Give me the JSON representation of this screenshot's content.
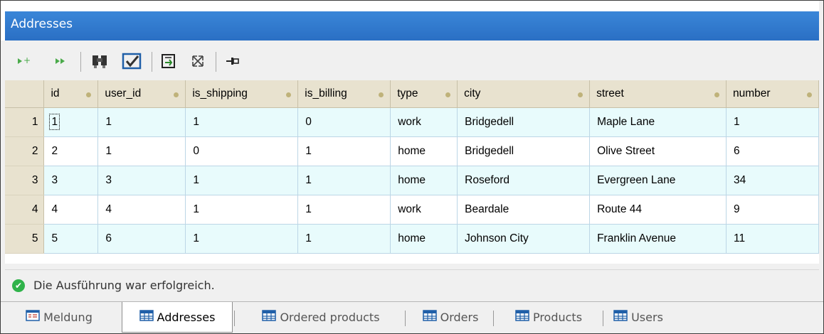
{
  "window": {
    "title": "Addresses"
  },
  "toolbar": {
    "buttons": [
      {
        "name": "append-row-icon"
      },
      {
        "name": "append-rows-icon"
      },
      {
        "name": "find-icon"
      },
      {
        "name": "commit-icon"
      },
      {
        "name": "export-icon"
      },
      {
        "name": "maximize-icon"
      },
      {
        "name": "pin-icon"
      }
    ]
  },
  "grid": {
    "columns": [
      "id",
      "user_id",
      "is_shipping",
      "is_billing",
      "type",
      "city",
      "street",
      "number"
    ],
    "rows": [
      {
        "n": "1",
        "cells": [
          "1",
          "1",
          "1",
          "0",
          "work",
          "Bridgedell",
          "Maple Lane",
          "1"
        ]
      },
      {
        "n": "2",
        "cells": [
          "2",
          "1",
          "0",
          "1",
          "home",
          "Bridgedell",
          "Olive Street",
          "6"
        ]
      },
      {
        "n": "3",
        "cells": [
          "3",
          "3",
          "1",
          "1",
          "home",
          "Roseford",
          "Evergreen Lane",
          "34"
        ]
      },
      {
        "n": "4",
        "cells": [
          "4",
          "4",
          "1",
          "1",
          "work",
          "Beardale",
          "Route 44",
          "9"
        ]
      },
      {
        "n": "5",
        "cells": [
          "5",
          "6",
          "1",
          "1",
          "home",
          "Johnson City",
          "Franklin Avenue",
          "11"
        ]
      }
    ]
  },
  "status": {
    "message": "Die Ausführung war erfolgreich."
  },
  "tabs": [
    {
      "label": "Meldung",
      "active": false
    },
    {
      "label": "Addresses",
      "active": true
    },
    {
      "label": "Ordered products",
      "active": false
    },
    {
      "label": "Orders",
      "active": false
    },
    {
      "label": "Products",
      "active": false
    },
    {
      "label": "Users",
      "active": false
    }
  ],
  "colors": {
    "titlebar": "#2a6fc4",
    "header": "#e8e2cf",
    "row_alt": "#e8fbfc",
    "success": "#2fb34a"
  }
}
